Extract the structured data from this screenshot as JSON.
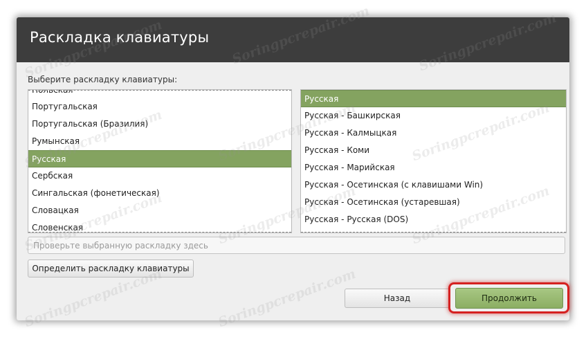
{
  "window": {
    "title": "Раскладка клавиатуры"
  },
  "prompt": "Выберите раскладку клавиатуры:",
  "layouts": {
    "items": [
      "Польская",
      "Португальская",
      "Португальская (Бразилия)",
      "Румынская",
      "Русская",
      "Сербская",
      "Сингальская (фонетическая)",
      "Словацкая",
      "Словенская"
    ],
    "selected": "Русская"
  },
  "variants": {
    "items": [
      "Русская",
      "Русская - Башкирская",
      "Русская - Калмыцкая",
      "Русская - Коми",
      "Русская - Марийская",
      "Русская - Осетинская (с клавишами Win)",
      "Русская - Осетинская (устаревшая)",
      "Русская - Русская (DOS)"
    ],
    "selected": "Русская"
  },
  "test_field": {
    "placeholder": "Проверьте выбранную раскладку здесь",
    "value": ""
  },
  "buttons": {
    "detect": "Определить раскладку клавиатуры",
    "back": "Назад",
    "continue": "Продолжить"
  },
  "watermark_text": "Soringpcrepair.com",
  "colors": {
    "titlebar": "#3d3d3d",
    "selection": "#84a360",
    "continue_button": "#8cae63",
    "highlight_ring": "#d52020"
  }
}
